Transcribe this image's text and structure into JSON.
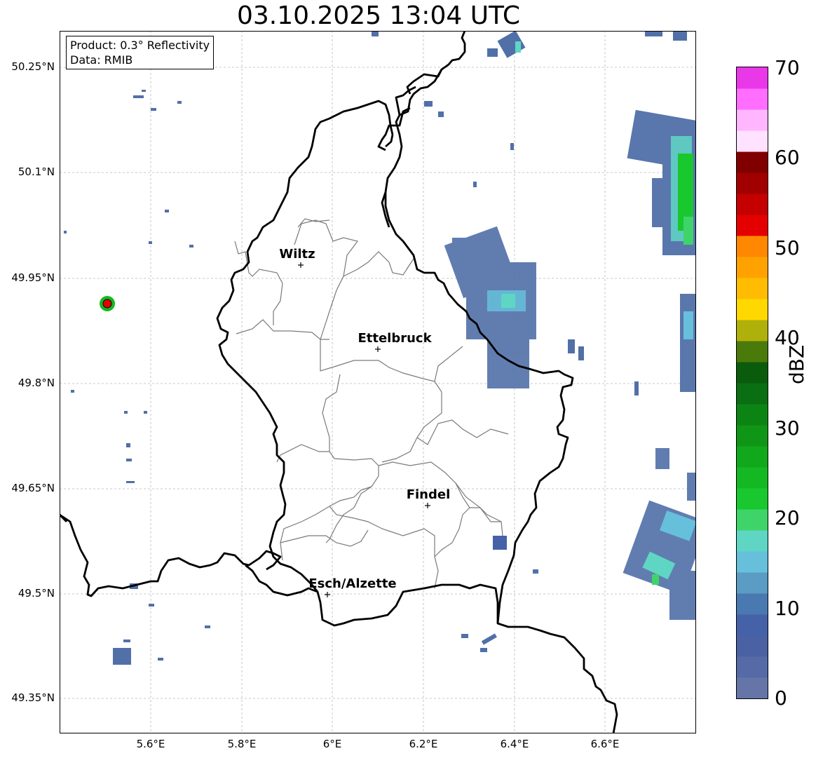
{
  "title": "03.10.2025 13:04 UTC",
  "info": {
    "product": "Product: 0.3° Reflectivity",
    "source": "Data: RMIB"
  },
  "lat_labels": [
    "50.25°N",
    "50.1°N",
    "49.95°N",
    "49.8°N",
    "49.65°N",
    "49.5°N",
    "49.35°N"
  ],
  "lon_labels": [
    "5.6°E",
    "5.8°E",
    "6°E",
    "6.2°E",
    "6.4°E",
    "6.6°E"
  ],
  "cities": [
    {
      "name": "Wiltz"
    },
    {
      "name": "Ettelbruck"
    },
    {
      "name": "Findel"
    },
    {
      "name": "Esch/Alzette"
    }
  ],
  "colorbar": {
    "unit": "dBZ",
    "ticks": [
      "0",
      "10",
      "20",
      "30",
      "40",
      "50",
      "60",
      "70"
    ],
    "colors": [
      "#6575a8",
      "#556aa6",
      "#4a62a3",
      "#4562a8",
      "#4a78b0",
      "#5a9cc4",
      "#66c0dc",
      "#5fd6c4",
      "#3ed46a",
      "#18c82e",
      "#14b822",
      "#12a81c",
      "#109616",
      "#0c8414",
      "#0a6e12",
      "#0a5c0c",
      "#4a7a0a",
      "#b0b00a",
      "#ffd800",
      "#ffbc00",
      "#ffa200",
      "#ff8800",
      "#e40000",
      "#c40000",
      "#a00000",
      "#800000",
      "#ffe2ff",
      "#ffb6ff",
      "#ff6eff",
      "#e838e8"
    ]
  }
}
